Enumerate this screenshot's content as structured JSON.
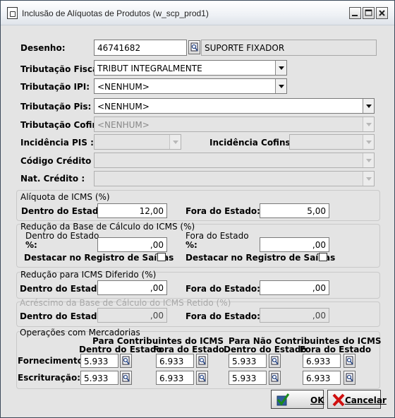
{
  "window": {
    "title": "Inclusão de Alíquotas de Produtos (w_scp_prod1)"
  },
  "labels": {
    "desenho": "Desenho:",
    "trib_fiscal": "Tributação Fiscal:",
    "trib_ipi": "Tributação IPI:",
    "trib_pis": "Tributação Pis:",
    "trib_cofins": "Tributação Cofins:",
    "incid_pis": "Incidência PIS :",
    "incid_cofins": "Incidência Cofins :",
    "cod_credito": "Código Crédito :",
    "nat_credito": "Nat. Crédito :"
  },
  "fields": {
    "desenho": "46741682",
    "descricao": "SUPORTE FIXADOR",
    "trib_fiscal": "TRIBUT INTEGRALMENTE",
    "trib_ipi": "<NENHUM>",
    "trib_pis": "<NENHUM>",
    "trib_cofins": "<NENHUM>"
  },
  "icms": {
    "title": "Alíquota de ICMS (%)",
    "dentro_label": "Dentro do Estado:",
    "dentro": "12,00",
    "fora_label": "Fora do Estado:",
    "fora": "5,00"
  },
  "reducao_base": {
    "title": "Redução da Base de Cálculo do ICMS (%)",
    "dentro_title": "Dentro do Estado",
    "fora_title": "Fora do Estado",
    "pct": "%:",
    "dentro": ",00",
    "fora": ",00",
    "destacar": "Destacar no Registro de Saídas"
  },
  "reducao_diferido": {
    "title": "Redução para ICMS Diferido (%)",
    "dentro_label": "Dentro do Estado:",
    "dentro": ",00",
    "fora_label": "Fora do Estado:",
    "fora": ",00"
  },
  "acrescimo": {
    "title": "Acréscimo da Base de Cálculo do ICMS Retido (%)",
    "dentro_label": "Dentro do Estado:",
    "dentro": ",00",
    "fora_label": "Fora do Estado:",
    "fora": ",00"
  },
  "operacoes": {
    "title": "Operações com Mercadorias",
    "contrib": "Para Contribuintes do ICMS",
    "nao_contrib": "Para Não Contribuintes do ICMS",
    "dentro": "Dentro do Estado",
    "fora": "Fora do Estado",
    "fornecimento_label": "Fornecimento:",
    "escrituracao_label": "Escrituração:",
    "fornecimento": [
      "5.933",
      "6.933",
      "5.933",
      "6.933"
    ],
    "escrituracao": [
      "5.933",
      "6.933",
      "5.933",
      "6.933"
    ]
  },
  "buttons": {
    "ok": "OK",
    "cancelar": "Cancelar"
  },
  "icons": {
    "lookup": "lookup-icon",
    "ok": "check-icon",
    "cancel": "red-x-icon"
  }
}
